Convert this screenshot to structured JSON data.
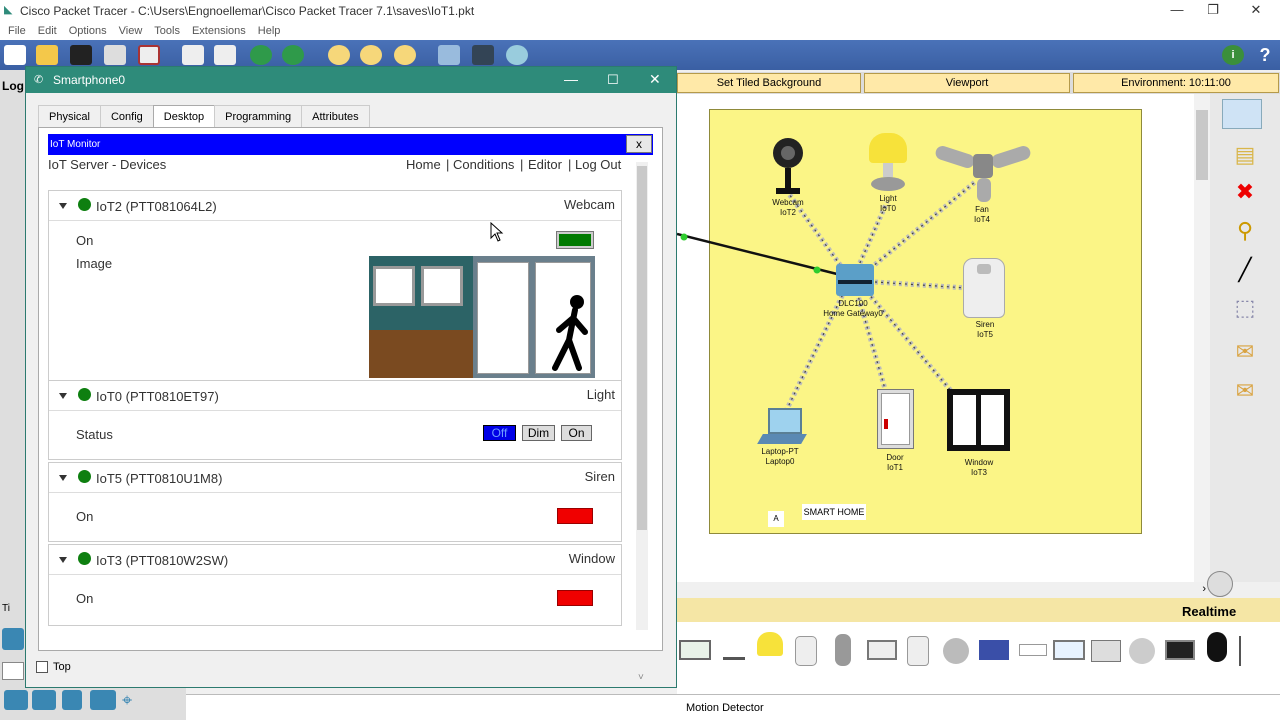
{
  "app": {
    "title": "Cisco Packet Tracer - C:\\Users\\Engnoellemar\\Cisco Packet Tracer 7.1\\saves\\IoT1.pkt",
    "minimize": "—",
    "restore": "❐",
    "close": "✕"
  },
  "menu": [
    "File",
    "Edit",
    "Options",
    "View",
    "Tools",
    "Extensions",
    "Help"
  ],
  "workspace": {
    "buttons": [
      "Set Tiled Background",
      "Viewport",
      "Environment: 10:11:00"
    ],
    "left_label": "Log"
  },
  "topology": {
    "devices": [
      {
        "id": "webcam",
        "line1": "Webcam",
        "line2": "IoT2"
      },
      {
        "id": "light",
        "line1": "Light",
        "line2": "IoT0"
      },
      {
        "id": "fan",
        "line1": "Fan",
        "line2": "IoT4"
      },
      {
        "id": "gateway",
        "line1": "DLC100",
        "line2": "Home Gateway0"
      },
      {
        "id": "siren",
        "line1": "Siren",
        "line2": "IoT5"
      },
      {
        "id": "laptop",
        "line1": "Laptop-PT",
        "line2": "Laptop0"
      },
      {
        "id": "door",
        "line1": "Door",
        "line2": "IoT1"
      },
      {
        "id": "window",
        "line1": "Window",
        "line2": "IoT3"
      }
    ],
    "note_a": "A",
    "note_smart": "SMART HOME"
  },
  "bottom": {
    "mode": "Realtime",
    "status": "Motion Detector",
    "left_label": "Ti"
  },
  "dialog": {
    "title": "Smartphone0",
    "tabs": [
      "Physical",
      "Config",
      "Desktop",
      "Programming",
      "Attributes"
    ],
    "active_tab": "Desktop",
    "top_checkbox_label": "Top",
    "iot_monitor": {
      "header": "IoT Monitor",
      "close": "x",
      "subtitle": "IoT Server - Devices",
      "nav": [
        "Home",
        "Conditions",
        "Editor",
        "Log Out"
      ],
      "separator": "|",
      "devices": [
        {
          "name": "IoT2 (PTT081064L2)",
          "type": "Webcam",
          "rows": [
            "On",
            "Image"
          ]
        },
        {
          "name": "IoT0 (PTT0810ET97)",
          "type": "Light",
          "rows": [
            "Status"
          ],
          "buttons": [
            "Off",
            "Dim",
            "On"
          ]
        },
        {
          "name": "IoT5 (PTT0810U1M8)",
          "type": "Siren",
          "rows": [
            "On"
          ]
        },
        {
          "name": "IoT3 (PTT0810W2SW)",
          "type": "Window",
          "rows": [
            "On"
          ]
        }
      ]
    }
  },
  "colors": {
    "dialog_title": "#2e8b7a",
    "iot_header": "#0000ff",
    "status_on": "#007a00",
    "status_off": "#f00000",
    "smart_home_bg": "#fbf586",
    "toolbar": "#3f66ab"
  }
}
